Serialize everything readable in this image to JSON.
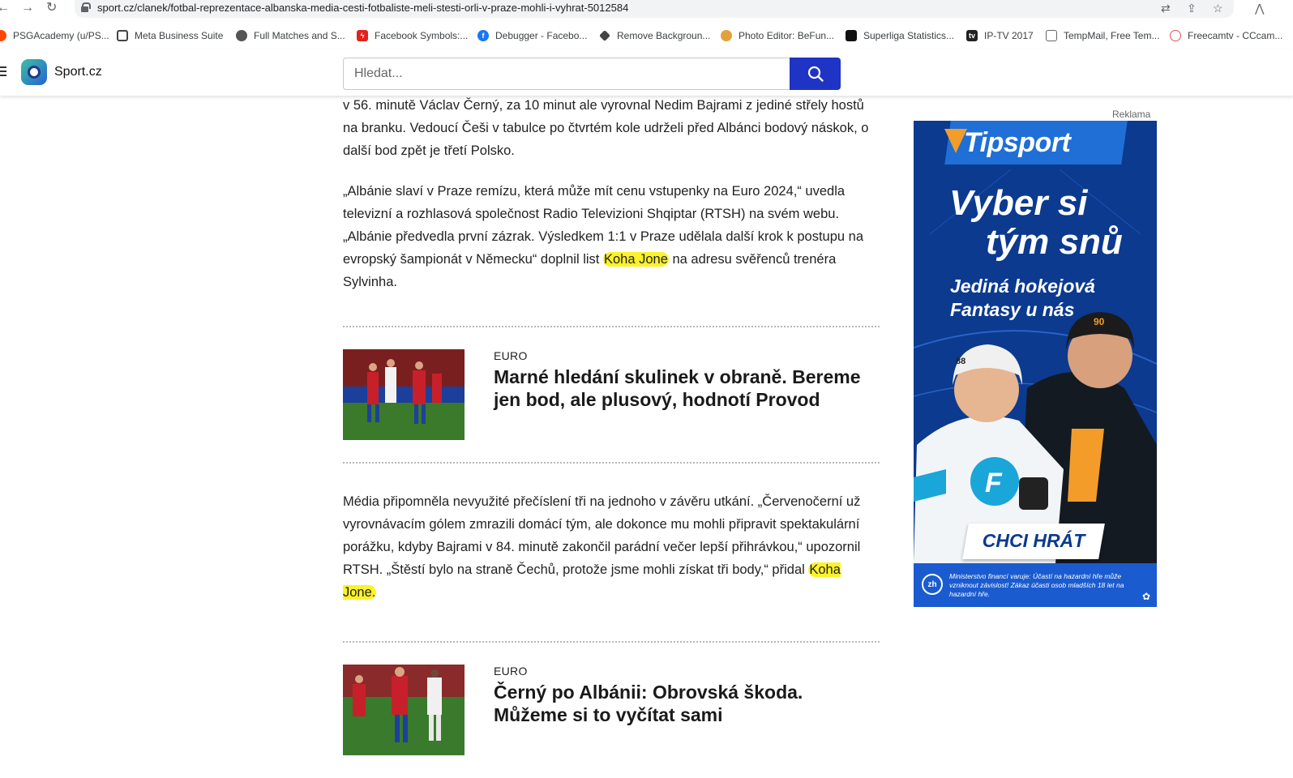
{
  "browser": {
    "url": "sport.cz/clanek/fotbal-reprezentace-albanska-media-cesti-fotbaliste-meli-stesti-orli-v-praze-mohli-i-vyhrat-5012584",
    "bookmarks": [
      {
        "label": "PSGAcademy (u/PS...",
        "icon": "reddit-icon",
        "color": "#ff4500"
      },
      {
        "label": "Meta Business Suite",
        "icon": "meta-suite-icon",
        "color": "#444444"
      },
      {
        "label": "Full Matches and S...",
        "icon": "globe-icon",
        "color": "#555555"
      },
      {
        "label": "Facebook Symbols:...",
        "icon": "bolt-icon",
        "color": "#e0241b"
      },
      {
        "label": "Debugger - Facebo...",
        "icon": "facebook-icon",
        "color": "#1877f2"
      },
      {
        "label": "Remove Backgroun...",
        "icon": "layers-icon",
        "color": "#444444"
      },
      {
        "label": "Photo Editor: BeFun...",
        "icon": "befunky-icon",
        "color": "#e2a23b"
      },
      {
        "label": "Superliga Statistics...",
        "icon": "superliga-icon",
        "color": "#111111"
      },
      {
        "label": "IP-TV 2017",
        "icon": "tv-icon",
        "color": "#222222"
      },
      {
        "label": "TempMail, Free Tem...",
        "icon": "mail-icon",
        "color": "#666666"
      },
      {
        "label": "Freecamtv - CCcam...",
        "icon": "cloud-icon",
        "color": "#e05555"
      }
    ]
  },
  "header": {
    "brand": "Sport.cz",
    "search_placeholder": "Hledat..."
  },
  "article": {
    "p1": "v 56. minutě Václav Černý, za 10 minut ale vyrovnal Nedim Bajrami z jediné střely hostů na branku. Vedoucí Češi v tabulce po čtvrtém kole udrželi před Albánci bodový náskok, o další bod zpět je třetí Polsko.",
    "p2_a": "„Albánie slaví v Praze remízu, která může mít cenu vstupenky na Euro 2024,“ uvedla televizní a rozhlasová společnost Radio Televizioni Shqiptar (RTSH) na svém webu. „Albánie předvedla první zázrak. Výsledkem 1:1 v Praze udělala další krok k postupu na evropský šampionát v Německu“ doplnil list ",
    "p2_hl": "Koha Jone",
    "p2_b": " na adresu svěřenců trenéra Sylvinha.",
    "p3_a": "Média připomněla nevyužité přečíslení tři na jednoho v závěru utkání. „Červenočerní už vyrovnávacím gólem zmrazili domácí tým, ale dokonce mu mohli připravit spektakulární porážku, kdyby Bajrami v 84. minutě zakončil parádní večer lepší přihrávkou,“ upozornil RTSH. „Štěstí bylo na straně Čechů, protože jsme mohli získat tři body,“ přidal ",
    "p3_hl": "Koha Jone.",
    "teasers": [
      {
        "category": "EURO",
        "title": "Marné hledání skulinek v obraně. Bereme jen bod, ale plusový, hodnotí Provod"
      },
      {
        "category": "EURO",
        "title": "Černý po Albánii: Obrovská škoda. Můžeme si to vyčítat sami"
      }
    ]
  },
  "ad": {
    "label": "Reklama",
    "logo": "Tipsport",
    "headline_1": "Vyber si",
    "headline_2": "tým snů",
    "subhead": "Jediná hokejová Fantasy u nás",
    "cta": "CHCI HRÁT",
    "footer_badge": "zh",
    "footer": "Ministerstvo financí varuje: Účastí na hazardní hře může vzniknout závislost! Zákaz účasti osob mladších 18 let na hazardní hře.",
    "jersey_1": "88",
    "jersey_2": "90",
    "jersey_letter": "F",
    "colors": {
      "background": "#0b3a8f",
      "logo_v": "#f39c2a",
      "accent": "#1f6fd6"
    }
  },
  "colors": {
    "highlight": "#fbf22a",
    "search_button": "#1f33c4"
  }
}
